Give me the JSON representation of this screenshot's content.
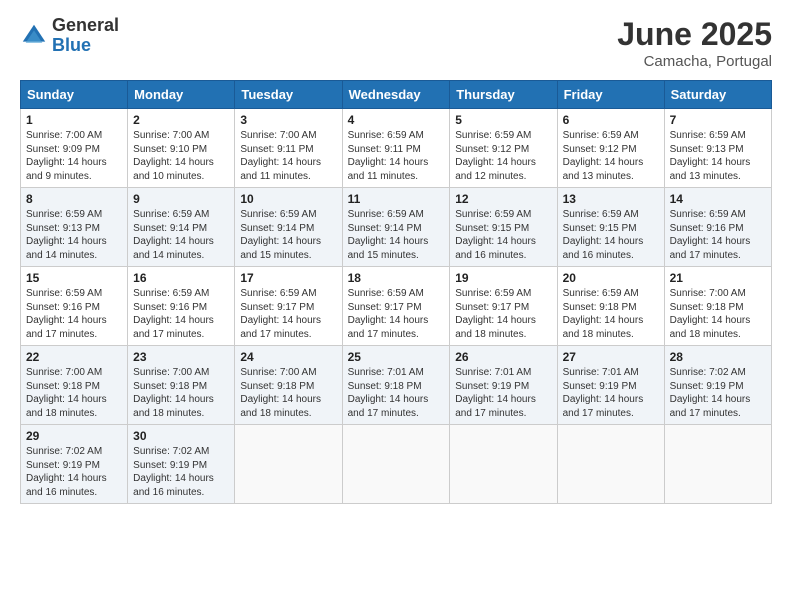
{
  "logo": {
    "general": "General",
    "blue": "Blue"
  },
  "title": "June 2025",
  "location": "Camacha, Portugal",
  "days_header": [
    "Sunday",
    "Monday",
    "Tuesday",
    "Wednesday",
    "Thursday",
    "Friday",
    "Saturday"
  ],
  "weeks": [
    [
      {
        "day": "1",
        "sunrise": "7:00 AM",
        "sunset": "9:09 PM",
        "daylight": "14 hours and 9 minutes."
      },
      {
        "day": "2",
        "sunrise": "7:00 AM",
        "sunset": "9:10 PM",
        "daylight": "14 hours and 10 minutes."
      },
      {
        "day": "3",
        "sunrise": "7:00 AM",
        "sunset": "9:11 PM",
        "daylight": "14 hours and 11 minutes."
      },
      {
        "day": "4",
        "sunrise": "6:59 AM",
        "sunset": "9:11 PM",
        "daylight": "14 hours and 11 minutes."
      },
      {
        "day": "5",
        "sunrise": "6:59 AM",
        "sunset": "9:12 PM",
        "daylight": "14 hours and 12 minutes."
      },
      {
        "day": "6",
        "sunrise": "6:59 AM",
        "sunset": "9:12 PM",
        "daylight": "14 hours and 13 minutes."
      },
      {
        "day": "7",
        "sunrise": "6:59 AM",
        "sunset": "9:13 PM",
        "daylight": "14 hours and 13 minutes."
      }
    ],
    [
      {
        "day": "8",
        "sunrise": "6:59 AM",
        "sunset": "9:13 PM",
        "daylight": "14 hours and 14 minutes."
      },
      {
        "day": "9",
        "sunrise": "6:59 AM",
        "sunset": "9:14 PM",
        "daylight": "14 hours and 14 minutes."
      },
      {
        "day": "10",
        "sunrise": "6:59 AM",
        "sunset": "9:14 PM",
        "daylight": "14 hours and 15 minutes."
      },
      {
        "day": "11",
        "sunrise": "6:59 AM",
        "sunset": "9:14 PM",
        "daylight": "14 hours and 15 minutes."
      },
      {
        "day": "12",
        "sunrise": "6:59 AM",
        "sunset": "9:15 PM",
        "daylight": "14 hours and 16 minutes."
      },
      {
        "day": "13",
        "sunrise": "6:59 AM",
        "sunset": "9:15 PM",
        "daylight": "14 hours and 16 minutes."
      },
      {
        "day": "14",
        "sunrise": "6:59 AM",
        "sunset": "9:16 PM",
        "daylight": "14 hours and 17 minutes."
      }
    ],
    [
      {
        "day": "15",
        "sunrise": "6:59 AM",
        "sunset": "9:16 PM",
        "daylight": "14 hours and 17 minutes."
      },
      {
        "day": "16",
        "sunrise": "6:59 AM",
        "sunset": "9:16 PM",
        "daylight": "14 hours and 17 minutes."
      },
      {
        "day": "17",
        "sunrise": "6:59 AM",
        "sunset": "9:17 PM",
        "daylight": "14 hours and 17 minutes."
      },
      {
        "day": "18",
        "sunrise": "6:59 AM",
        "sunset": "9:17 PM",
        "daylight": "14 hours and 17 minutes."
      },
      {
        "day": "19",
        "sunrise": "6:59 AM",
        "sunset": "9:17 PM",
        "daylight": "14 hours and 18 minutes."
      },
      {
        "day": "20",
        "sunrise": "6:59 AM",
        "sunset": "9:18 PM",
        "daylight": "14 hours and 18 minutes."
      },
      {
        "day": "21",
        "sunrise": "7:00 AM",
        "sunset": "9:18 PM",
        "daylight": "14 hours and 18 minutes."
      }
    ],
    [
      {
        "day": "22",
        "sunrise": "7:00 AM",
        "sunset": "9:18 PM",
        "daylight": "14 hours and 18 minutes."
      },
      {
        "day": "23",
        "sunrise": "7:00 AM",
        "sunset": "9:18 PM",
        "daylight": "14 hours and 18 minutes."
      },
      {
        "day": "24",
        "sunrise": "7:00 AM",
        "sunset": "9:18 PM",
        "daylight": "14 hours and 18 minutes."
      },
      {
        "day": "25",
        "sunrise": "7:01 AM",
        "sunset": "9:18 PM",
        "daylight": "14 hours and 17 minutes."
      },
      {
        "day": "26",
        "sunrise": "7:01 AM",
        "sunset": "9:19 PM",
        "daylight": "14 hours and 17 minutes."
      },
      {
        "day": "27",
        "sunrise": "7:01 AM",
        "sunset": "9:19 PM",
        "daylight": "14 hours and 17 minutes."
      },
      {
        "day": "28",
        "sunrise": "7:02 AM",
        "sunset": "9:19 PM",
        "daylight": "14 hours and 17 minutes."
      }
    ],
    [
      {
        "day": "29",
        "sunrise": "7:02 AM",
        "sunset": "9:19 PM",
        "daylight": "14 hours and 16 minutes."
      },
      {
        "day": "30",
        "sunrise": "7:02 AM",
        "sunset": "9:19 PM",
        "daylight": "14 hours and 16 minutes."
      },
      null,
      null,
      null,
      null,
      null
    ]
  ],
  "labels": {
    "sunrise": "Sunrise:",
    "sunset": "Sunset:",
    "daylight": "Daylight:"
  }
}
